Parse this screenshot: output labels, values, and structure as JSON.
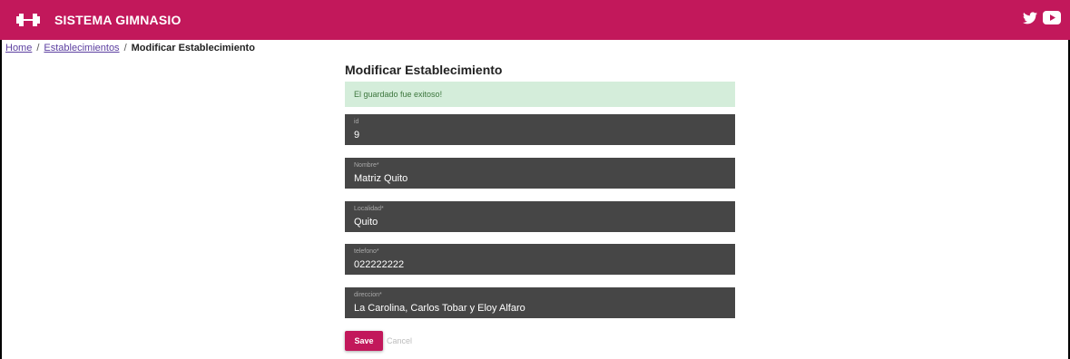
{
  "header": {
    "title": "SISTEMA GIMNASIO",
    "logo_icon": "dumbbell-icon",
    "social_icons": [
      "twitter-icon",
      "youtube-icon"
    ],
    "brand_color": "#c2185b"
  },
  "breadcrumb": {
    "home": "Home",
    "section": "Establecimientos",
    "separator": "/",
    "current": "Modificar Establecimiento"
  },
  "form": {
    "title": "Modificar Establecimiento",
    "alert": "El guardado fue exitoso!",
    "alert_color": "#d4edda",
    "fields": [
      {
        "label": "id",
        "value": "9"
      },
      {
        "label": "Nombre*",
        "value": "Matriz Quito"
      },
      {
        "label": "Localidad*",
        "value": "Quito"
      },
      {
        "label": "telefono*",
        "value": "022222222"
      },
      {
        "label": "direccion*",
        "value": "La Carolina, Carlos Tobar y Eloy Alfaro"
      }
    ],
    "save_label": "Save",
    "cancel_label": "Cancel"
  }
}
